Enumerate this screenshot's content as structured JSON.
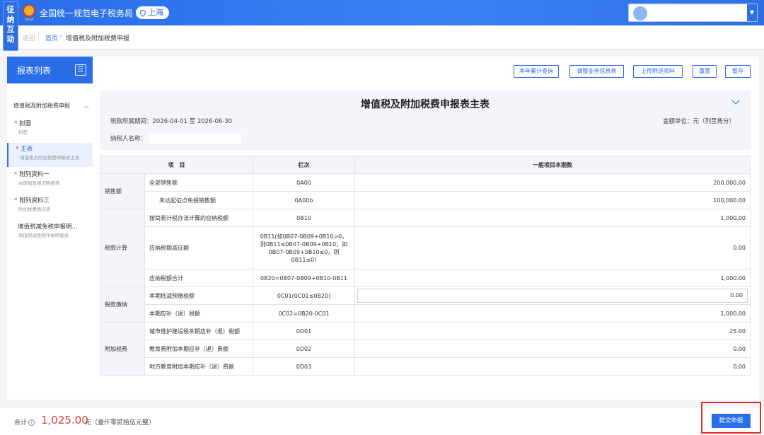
{
  "side_tag": [
    "征",
    "纳",
    "互",
    "动"
  ],
  "header": {
    "emblem_text": "TAXA",
    "site_title": "全国统一规范电子税务局",
    "region": "上海"
  },
  "breadcrumb": {
    "back": "返回",
    "home": "首页",
    "separator": "›",
    "current": "增值税及附加税费申报"
  },
  "sidebar": {
    "title": "报表列表",
    "group": "增值税及附加税费申报",
    "items": [
      {
        "name": "封面",
        "sub": "封面",
        "required": true
      },
      {
        "name": "主表",
        "sub": "增值税及附加税费申报表主表",
        "required": true
      },
      {
        "name": "附列资料一",
        "sub": "本期销售情况明细表",
        "required": true
      },
      {
        "name": "附列资料三",
        "sub": "附加税费情况表",
        "required": true
      },
      {
        "name": "增值税减免税申报明...",
        "sub": "增值税减免税申报明细表",
        "required": false
      }
    ]
  },
  "toolbar": {
    "annual_query": "本年累计查询",
    "adjust_info": "调整业务信息表",
    "upload": "上传附送资料",
    "reset": "重置",
    "save_draft": "暂存"
  },
  "form": {
    "title": "增值税及附加税费申报表主表",
    "period_label": "税款所属期间：",
    "period_value": "2026-04-01 至 2026-06-30",
    "unit": "金额单位：元（列至角分）",
    "taxpayer_label": "纳税人名称："
  },
  "table": {
    "headers": [
      "项　目",
      "栏次",
      "一般项目本期数"
    ],
    "groups": {
      "sales": "销售额",
      "calc": "税款计算",
      "payment": "税款缴纳",
      "surcharge": "附加税费"
    },
    "rows": [
      {
        "item": "全部销售额",
        "col": "0A00",
        "value": "200,000.00"
      },
      {
        "item": "未达起征点免税销售额",
        "col": "0A00b",
        "value": "100,000.00"
      },
      {
        "item": "按简易计税办法计算的应纳税额",
        "col": "0B10",
        "value": "1,000.00"
      },
      {
        "item": "应纳税额减征额",
        "col": "0B11(如0B07-0B09+0B10>0，则0B11≤0B07-0B09+0B10；如0B07-0B09+0B10≤0，则0B11≤0)",
        "value": "0.00"
      },
      {
        "item": "应纳税额合计",
        "col": "0B20=0B07-0B09+0B10-0B11",
        "value": "1,000.00"
      },
      {
        "item": "本期抵减预缴税额",
        "col": "0C01(0C01≤0B20)",
        "value": "0.00"
      },
      {
        "item": "本期应补（退）税额",
        "col": "0C02=0B20-0C01",
        "value": "1,000.00"
      },
      {
        "item": "城市维护建设税本期应补（退）税额",
        "col": "0D01",
        "value": "25.00"
      },
      {
        "item": "教育费附加本期应补（退）费额",
        "col": "0D02",
        "value": "0.00"
      },
      {
        "item": "地方教育附加本期应补（退）费额",
        "col": "0D03",
        "value": "0.00"
      }
    ]
  },
  "footer": {
    "total_label": "合计",
    "total_amount": "1,025.00",
    "total_unit": "元（壹仟零贰拾伍元整）",
    "submit": "提交申报"
  },
  "colors": {
    "primary": "#2a6de8",
    "accent_red": "#e23c3c",
    "highlight_frame": "#e02b2b"
  }
}
